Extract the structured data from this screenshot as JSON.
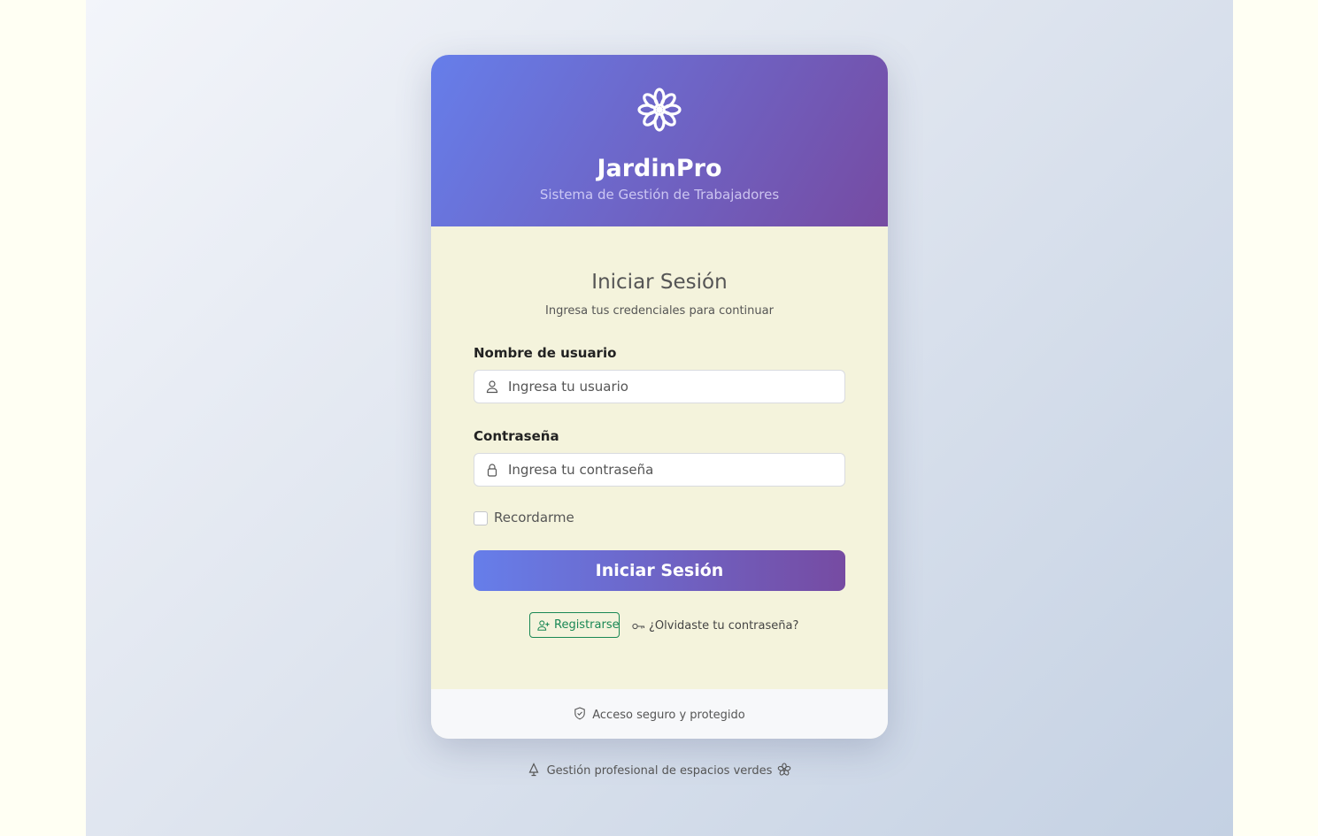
{
  "brand": {
    "name": "JardinPro",
    "tagline": "Sistema de Gestión de Trabajadores",
    "logo_icon": "flower-icon"
  },
  "login": {
    "title": "Iniciar Sesión",
    "subtitle": "Ingresa tus credenciales para continuar",
    "username": {
      "label": "Nombre de usuario",
      "placeholder": "Ingresa tu usuario",
      "value": "",
      "icon": "person-icon"
    },
    "password": {
      "label": "Contraseña",
      "placeholder": "Ingresa tu contraseña",
      "value": "",
      "icon": "lock-icon"
    },
    "remember_label": "Recordarme",
    "remember_checked": false,
    "submit_label": "Iniciar Sesión",
    "register_label": "Registrarse",
    "forgot_label": "¿Olvidaste tu contraseña?"
  },
  "card_footer": {
    "text": "Acceso seguro y protegido",
    "icon": "shield-check-icon"
  },
  "page_footer": {
    "text": "Gestión profesional de espacios verdes",
    "left_icon": "tree-icon",
    "right_icon": "flower-icon"
  },
  "colors": {
    "gradient_start": "#667eea",
    "gradient_end": "#764ba2",
    "register_green": "#198754",
    "form_background": "#f4f3dc"
  }
}
